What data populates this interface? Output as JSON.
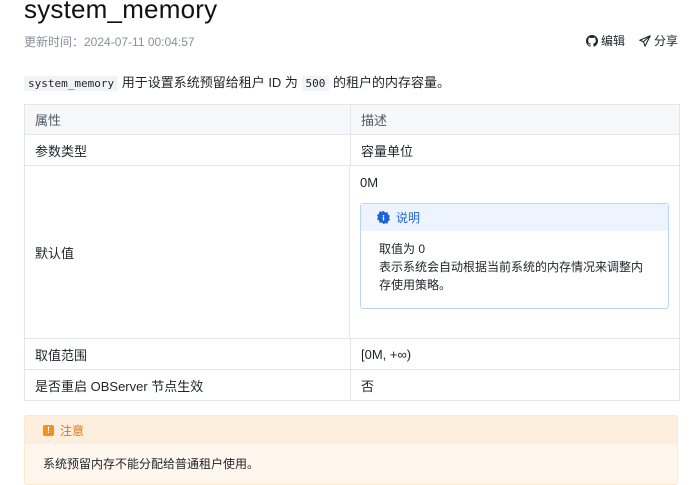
{
  "page": {
    "title": "system_memory",
    "updated_label": "更新时间：2024-07-11 00:04:57",
    "actions": {
      "edit": "编辑",
      "share": "分享"
    }
  },
  "intro": {
    "param": "system_memory",
    "text_a": " 用于设置系统预留给租户 ID 为 ",
    "tenant_id": "500",
    "text_b": " 的租户的内存容量。"
  },
  "table": {
    "headers": [
      "属性",
      "描述"
    ],
    "rows": [
      {
        "attr": "参数类型",
        "desc": "容量单位"
      },
      {
        "attr": "默认值",
        "desc": "0M"
      },
      {
        "attr": "取值范围",
        "desc": "[0M, +∞)"
      },
      {
        "attr": "是否重启 OBServer 节点生效",
        "desc": "否"
      }
    ],
    "note": {
      "title": "说明",
      "line1": "取值为 0",
      "line2": "表示系统会自动根据当前系统的内存情况来调整内存使用策略。"
    }
  },
  "warning": {
    "title": "注意",
    "text": "系统预留内存不能分配给普通租户使用。"
  },
  "colors": {
    "info": "#1d64d8",
    "warn": "#e37318"
  }
}
